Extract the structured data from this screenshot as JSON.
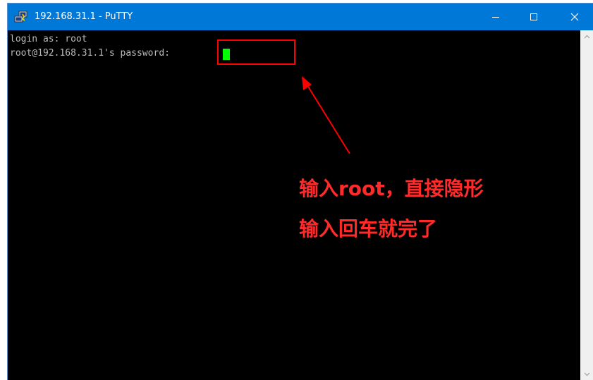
{
  "window": {
    "title": "192.168.31.1 - PuTTY",
    "icon": "putty-app-icon",
    "controls": [
      "minimize-icon",
      "maximize-icon",
      "close-icon"
    ]
  },
  "terminal": {
    "lines": [
      "login as: root",
      "root@192.168.31.1's password: "
    ],
    "cursor_color": "#00ff00",
    "text_color": "#bbbbbb",
    "background": "#000000"
  },
  "annotation": {
    "line1": "输入root，直接隐形",
    "line2": "输入回车就完了",
    "color": "#ff2a2a"
  },
  "colors": {
    "titlebar": "#0078d7"
  }
}
